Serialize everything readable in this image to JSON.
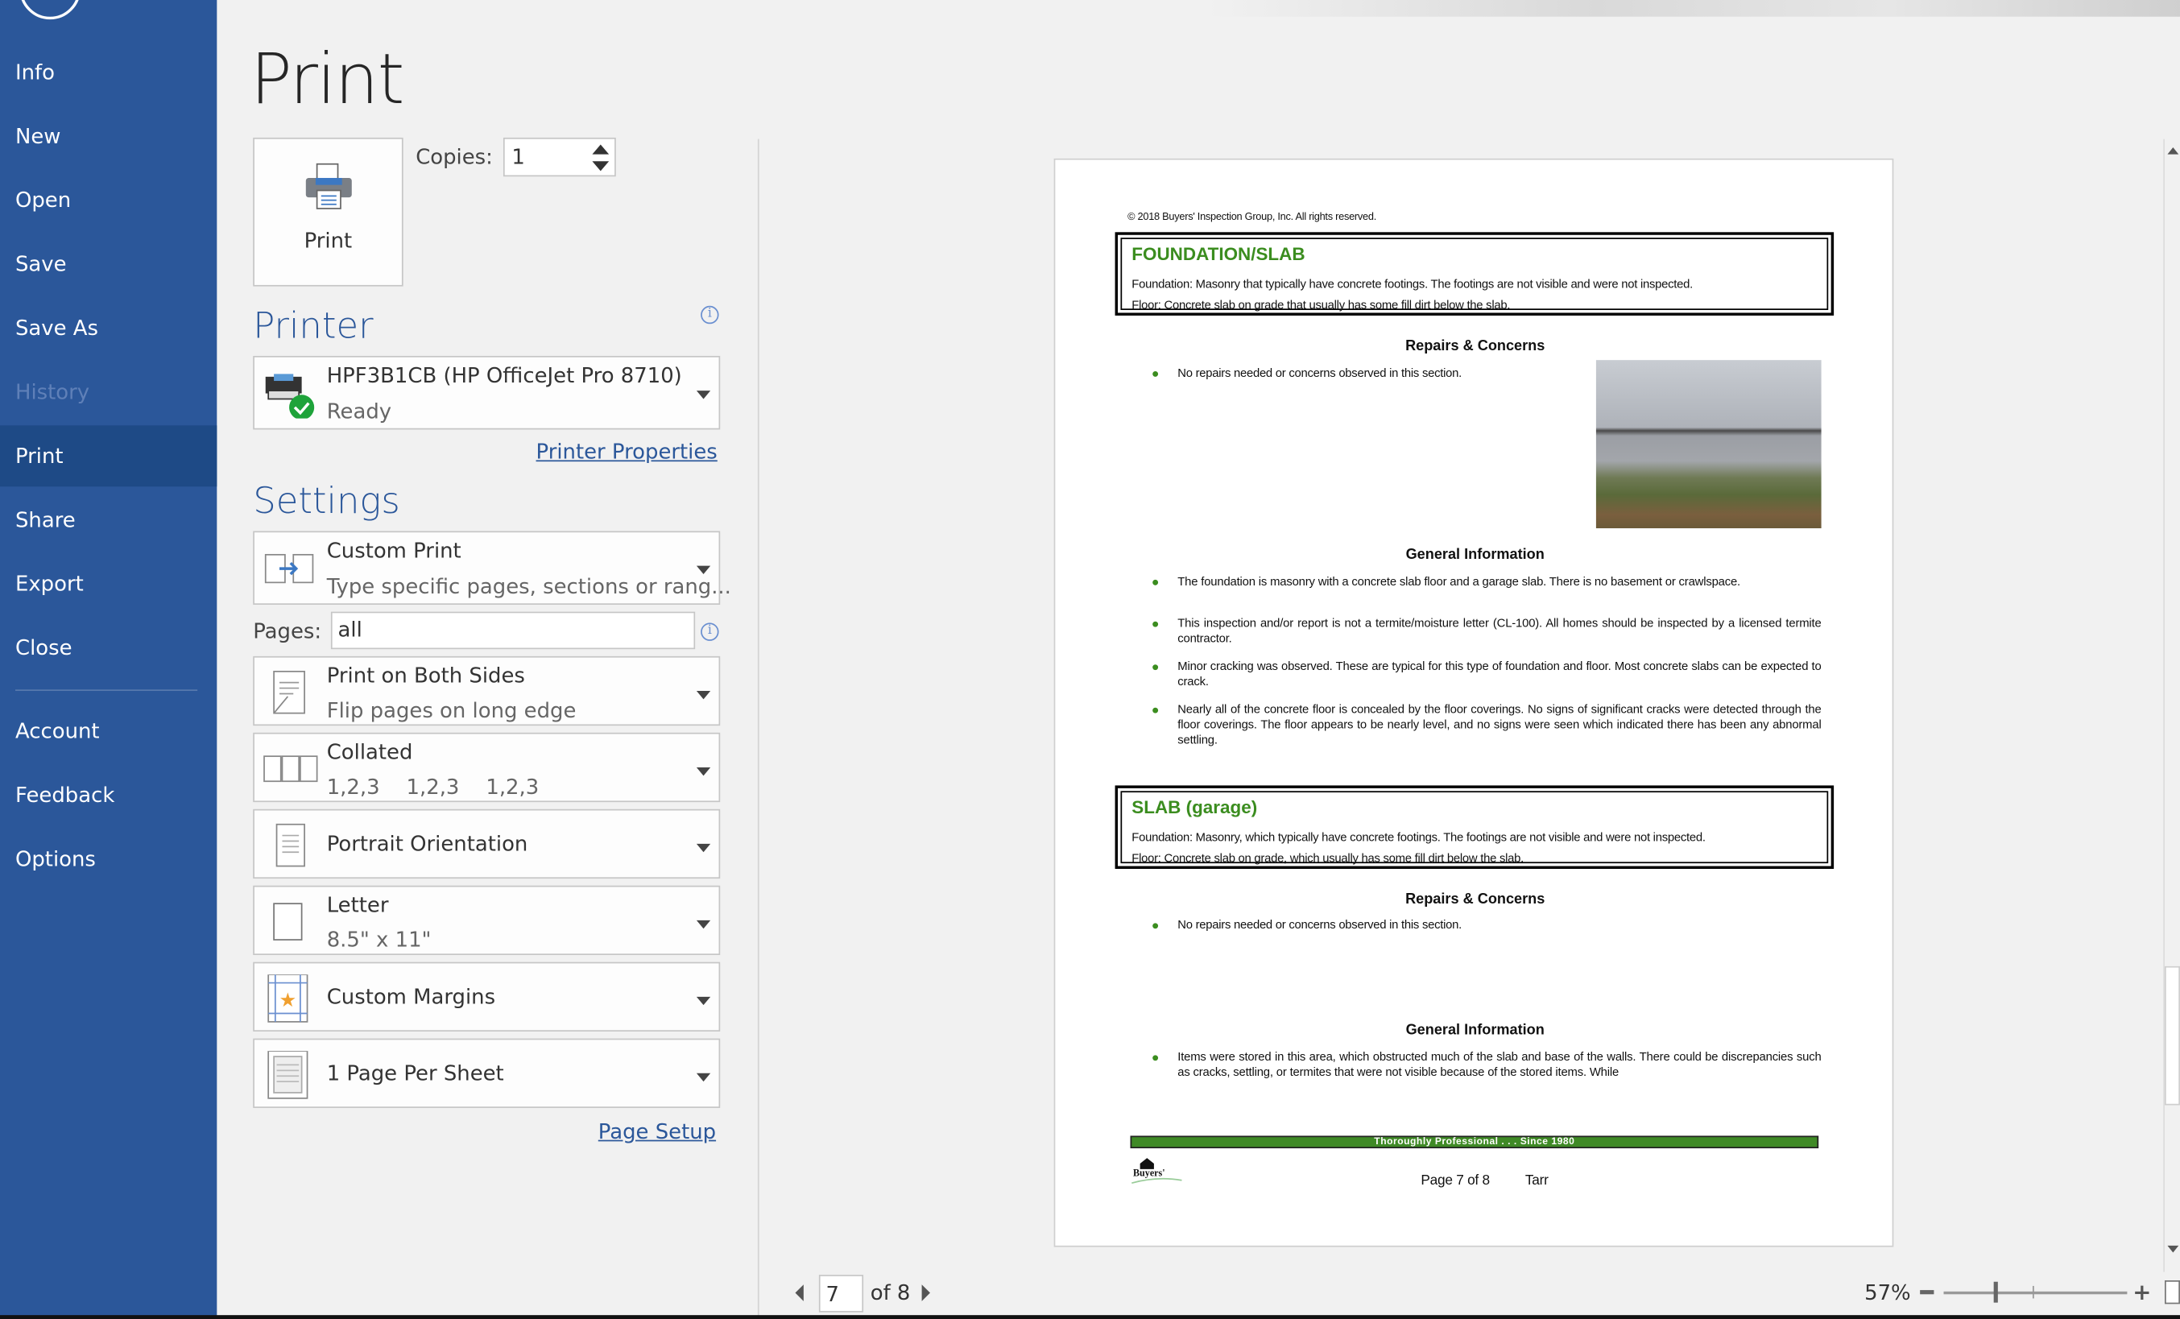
{
  "sidebar": {
    "items": [
      {
        "label": "Info"
      },
      {
        "label": "New"
      },
      {
        "label": "Open"
      },
      {
        "label": "Save"
      },
      {
        "label": "Save As"
      },
      {
        "label": "History"
      },
      {
        "label": "Print"
      },
      {
        "label": "Share"
      },
      {
        "label": "Export"
      },
      {
        "label": "Close"
      },
      {
        "label": "Account"
      },
      {
        "label": "Feedback"
      },
      {
        "label": "Options"
      }
    ],
    "selected": "Print",
    "accent": "#2b579a"
  },
  "main": {
    "title": "Print",
    "print_button": "Print",
    "copies_label": "Copies:",
    "copies_value": "1",
    "printer_heading": "Printer",
    "printer": {
      "name": "HPF3B1CB (HP OfficeJet Pro 8710)",
      "status": "Ready"
    },
    "printer_properties": "Printer Properties",
    "settings_heading": "Settings",
    "settings": [
      {
        "title": "Custom Print",
        "subtitle": "Type specific pages, sections or rang..."
      },
      {
        "title": "Print on Both Sides",
        "subtitle": "Flip pages on long edge"
      },
      {
        "title": "Collated",
        "subtitle": "1,2,3    1,2,3    1,2,3"
      },
      {
        "title": "Portrait Orientation"
      },
      {
        "title": "Letter",
        "subtitle": "8.5\" x 11\""
      },
      {
        "title": "Custom Margins"
      },
      {
        "title": "1 Page Per Sheet"
      }
    ],
    "pages_label": "Pages:",
    "pages_value": "all",
    "page_setup": "Page Setup"
  },
  "preview": {
    "copyright": "© 2018 Buyers' Inspection Group, Inc.  All rights reserved.",
    "section1": {
      "title": "FOUNDATION/SLAB",
      "line1": "Foundation: Masonry that typically have concrete footings. The footings are not visible and were not inspected.",
      "line2": "Floor: Concrete slab on grade that usually has some fill dirt below the slab.",
      "repairs_heading": "Repairs & Concerns",
      "repairs": "No repairs needed or concerns observed in this section.",
      "general_heading": "General Information",
      "general": [
        "The foundation is masonry with a concrete slab floor and a garage slab. There is no basement or crawlspace.",
        "This inspection and/or report is not a termite/moisture letter (CL-100). All homes should be inspected by a licensed termite contractor.",
        "Minor cracking was observed. These are typical for this type of foundation and floor. Most concrete slabs can be expected to crack.",
        "Nearly all of the concrete floor is concealed by the floor coverings. No signs of significant cracks were detected through the floor coverings. The floor appears to be nearly level, and no signs were seen which indicated there has been any abnormal settling."
      ]
    },
    "section2": {
      "title": "SLAB (garage)",
      "line1": "Foundation: Masonry, which typically have concrete footings. The footings are not visible and were not inspected.",
      "line2": "Floor: Concrete slab on grade, which usually has some fill dirt below the slab.",
      "repairs_heading": "Repairs & Concerns",
      "repairs": "No repairs needed or concerns observed in this section.",
      "general_heading": "General Information",
      "general": [
        "Items were stored in this area, which obstructed much of the slab and base of the walls. There could be discrepancies such as cracks, settling, or termites that were not visible because of the stored items. While"
      ]
    },
    "footer_bar": "Thoroughly Professional . . . Since 1980",
    "footer_page": "Page 7 of 8",
    "footer_name": "Tarr",
    "logo_text": "Buyers'",
    "green": "#3b8d1f"
  },
  "navigation": {
    "current_page": "7",
    "of_pages": "of 8"
  },
  "zoom": {
    "label": "57%",
    "percent": 57
  }
}
